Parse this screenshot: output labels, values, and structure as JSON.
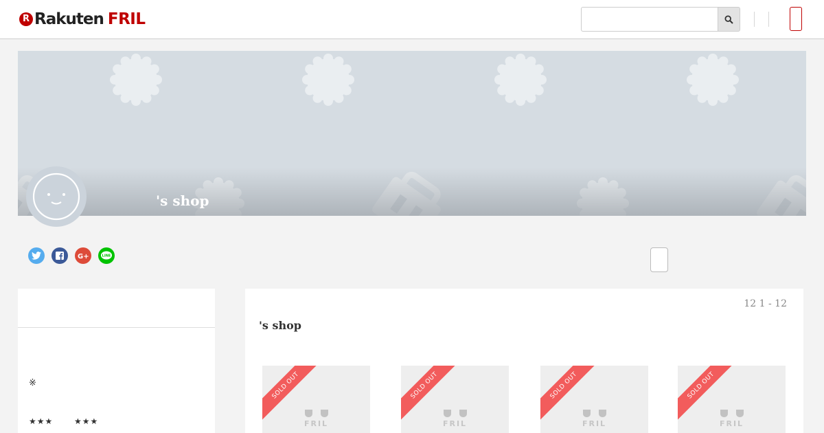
{
  "header": {
    "logo": {
      "r_mark": "R",
      "rakuten": "Rakuten",
      "fril": "FRIL"
    },
    "search": {
      "placeholder": "",
      "value": "",
      "icon": "search-icon"
    },
    "accent": "#bf0000"
  },
  "banner": {
    "shop_name": "'s shop",
    "background": "#d5dce2"
  },
  "social": {
    "items": [
      {
        "name": "twitter-icon",
        "color": "#55acee"
      },
      {
        "name": "facebook-icon",
        "color": "#3b5998"
      },
      {
        "name": "google-plus-icon",
        "color": "#dd4b39"
      },
      {
        "name": "line-icon",
        "color": "#00c300",
        "label": "LINE"
      }
    ]
  },
  "sidebar": {
    "note": "※",
    "ratings": [
      "★★★",
      "★★★"
    ]
  },
  "main": {
    "count": "12 1 - 12",
    "title": "'s shop",
    "items": [
      {
        "ribbon": "SOLD OUT",
        "placeholder": "FRIL"
      },
      {
        "ribbon": "SOLD OUT",
        "placeholder": "FRIL"
      },
      {
        "ribbon": "SOLD OUT",
        "placeholder": "FRIL"
      },
      {
        "ribbon": "SOLD OUT",
        "placeholder": "FRIL"
      }
    ]
  }
}
